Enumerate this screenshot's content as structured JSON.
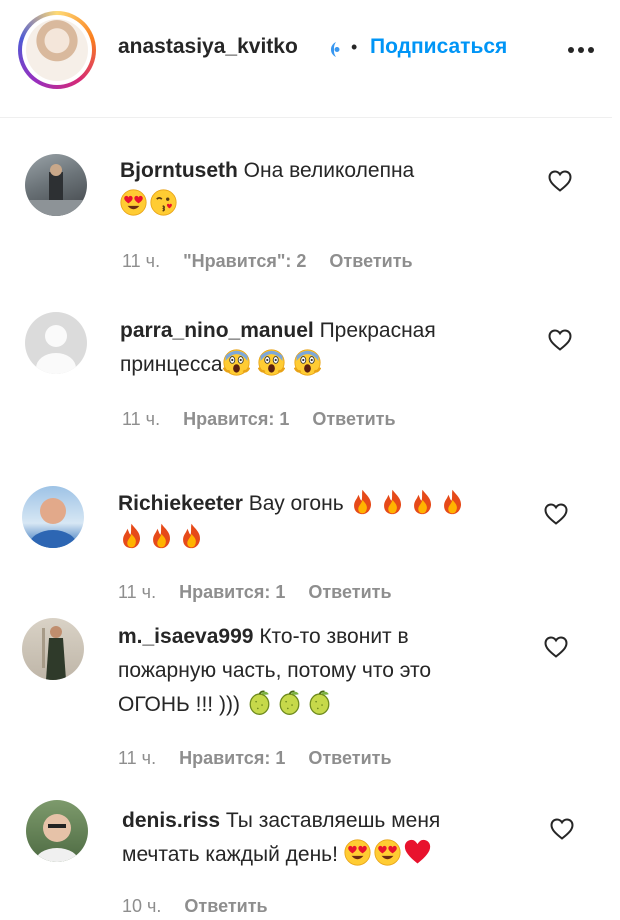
{
  "header": {
    "username": "anastasiya_kvitko",
    "separator": "•",
    "follow_label": "Подписаться"
  },
  "comments": [
    {
      "username": "Bjorntuseth",
      "line1": "Она великолепна",
      "line2": "",
      "emojis": [
        "heart-eyes-emoji",
        "kiss-wink-emoji"
      ],
      "time": "11 ч.",
      "likes": "\"Нравится\": 2",
      "reply": "Ответить"
    },
    {
      "username": "parra_nino_manuel",
      "line1": "Прекрасная",
      "line2": "принцесса",
      "emojis": [
        "scream-emoji",
        "scream-emoji",
        "scream-emoji"
      ],
      "time": "11 ч.",
      "likes": "Нравится: 1",
      "reply": "Ответить"
    },
    {
      "username": "Richiekeeter",
      "line1": "Вау огонь",
      "line2": "",
      "emojis": [
        "fire-emoji",
        "fire-emoji",
        "fire-emoji",
        "fire-emoji",
        "fire-emoji",
        "fire-emoji",
        "fire-emoji"
      ],
      "time": "11 ч.",
      "likes": "Нравится: 1",
      "reply": "Ответить"
    },
    {
      "username": "m._isaeva999",
      "line1": "Кто-то звонит в",
      "line2": "пожарную часть, потому что это",
      "line3": "ОГОНЬ !!! )))",
      "emojis": [
        "lime-emoji",
        "lime-emoji",
        "lime-emoji"
      ],
      "time": "11 ч.",
      "likes": "Нравится: 1",
      "reply": "Ответить"
    },
    {
      "username": "denis.riss",
      "line1": "Ты заставляешь меня",
      "line2": "мечтать каждый день!",
      "emojis": [
        "heart-eyes-emoji",
        "heart-eyes-emoji",
        "red-heart-emoji"
      ],
      "time": "10 ч.",
      "likes": "",
      "reply": "Ответить"
    }
  ],
  "colors": {
    "follow_blue": "#0095f6",
    "meta_gray": "#8e8e8e",
    "text": "#262626"
  }
}
